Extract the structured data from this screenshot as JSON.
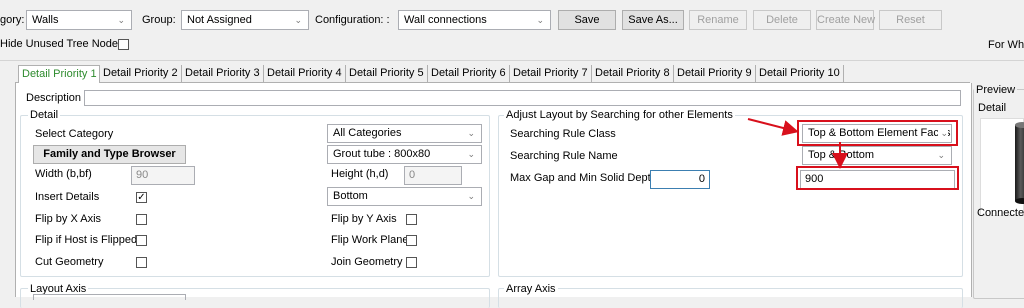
{
  "toolbar": {
    "category_label": "gory:",
    "category_value": "Walls",
    "group_label": "Group:",
    "group_value": "Not Assigned",
    "config_label": "Configuration:  :",
    "config_value": "Wall connections",
    "save": "Save",
    "save_as": "Save As...",
    "rename": "Rename",
    "delete": "Delete",
    "create_new": "Create New",
    "reset": "Reset",
    "hide_unused": "Hide Unused Tree Nodes",
    "right_cut": "For Who"
  },
  "tabs": [
    "Detail Priority 1",
    "Detail Priority 2",
    "Detail Priority 3",
    "Detail Priority 4",
    "Detail Priority 5",
    "Detail Priority 6",
    "Detail Priority 7",
    "Detail Priority 8",
    "Detail Priority 9",
    "Detail Priority 10"
  ],
  "description_label": "Description",
  "detail": {
    "title": "Detail",
    "select_category": "Select Category",
    "family_browser": "Family and Type Browser",
    "width_label": "Width (b,bf)",
    "width_value": "90",
    "insert_details": "Insert Details",
    "insert_details_checked": "✓",
    "flip_x": "Flip by X Axis",
    "flip_host": "Flip if Host is Flipped",
    "cut_geometry": "Cut Geometry",
    "all_categories": "All Categories",
    "grout_tube": "Grout tube : 800x80",
    "height_label": "Height (h,d)",
    "height_value": "0",
    "bottom": "Bottom",
    "flip_y": "Flip by Y Axis",
    "flip_work": "Flip Work Plane",
    "join_geometry": "Join Geometry"
  },
  "adjust": {
    "title": "Adjust Layout by Searching for other Elements",
    "rule_class_label": "Searching Rule Class",
    "rule_class_value": "Top & Bottom Element Faces",
    "rule_name_label": "Searching Rule Name",
    "rule_name_value": "Top & Bottom",
    "max_gap_label": "Max Gap and Min Solid Depth",
    "max_gap_value": "0",
    "depth_value": "900"
  },
  "layout_axis": "Layout Axis",
  "array_axis": "Array Axis",
  "preview": {
    "title": "Preview",
    "detail": "Detail",
    "connected": "Connected"
  }
}
